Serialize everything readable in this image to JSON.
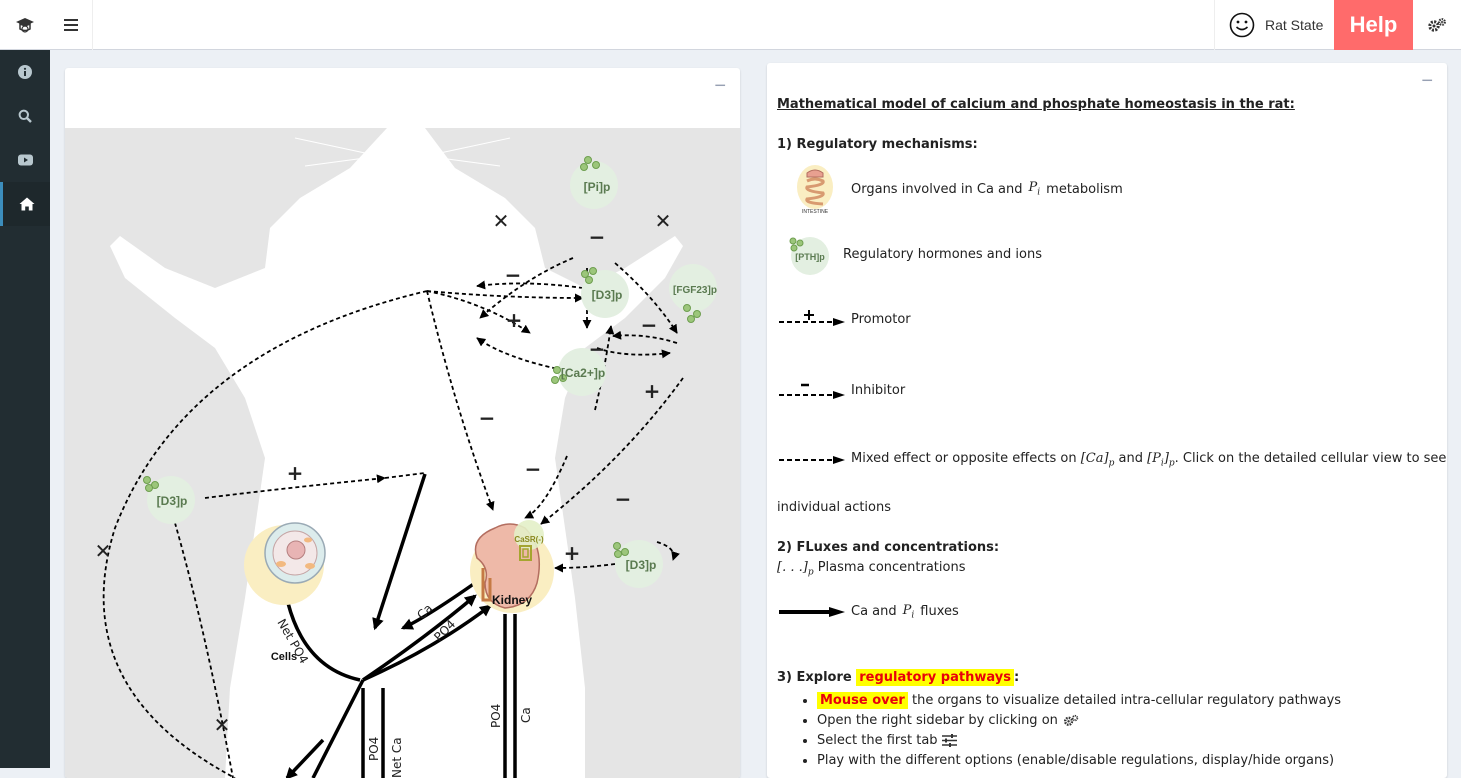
{
  "header": {
    "rat_state_label": "Rat State",
    "help_label": "Help"
  },
  "sidebar": {
    "items": [
      {
        "icon": "info-icon"
      },
      {
        "icon": "search-icon"
      },
      {
        "icon": "video-icon"
      },
      {
        "icon": "home-icon",
        "active": true
      }
    ]
  },
  "left_box": {
    "collapse_label": "−",
    "diagram": {
      "nodes": {
        "pi": "[Pi]p",
        "d3_top": "[D3]p",
        "fgf23": "[FGF23]p",
        "ca2": "[Ca2+]p",
        "d3_left": "[D3]p",
        "d3_right": "[D3]p",
        "casr": "CaSR(-)",
        "cells": "Cells",
        "kidney": "Kidney"
      },
      "signs": {
        "x1": "✕",
        "x2": "✕",
        "x3": "✕",
        "x4": "✕",
        "x5": "✕",
        "minus1": "−",
        "minus2": "−",
        "minus3": "−",
        "minus4": "−",
        "minus5": "−",
        "minus6": "−",
        "minus7": "−",
        "plus1": "+",
        "plus2": "+",
        "plus3": "+",
        "plus4": "+"
      },
      "flux_labels": {
        "ca_kid": "Ca",
        "po4_kid": "PO4",
        "net_po4": "Net PO4",
        "po4_down": "PO4",
        "ca_down": "Ca",
        "po4_vert": "PO4",
        "ca_vert": "Net Ca"
      }
    }
  },
  "right_box": {
    "collapse_label": "−",
    "title": "Mathematical model of calcium and phosphate homeostasis in the rat:",
    "section1": "1) Regulatory mechanisms:",
    "organs_text": "Organs involved in Ca and",
    "organs_math": "P",
    "organs_sub": "i",
    "organs_tail": "metabolism",
    "hormone_icon_label": "[PTH]p",
    "hormones_text": "Regulatory hormones and ions",
    "promotor": "Promotor",
    "inhibitor": "Inhibitor",
    "mixed_text": "Mixed effect or opposite effects on",
    "mixed_ca": "[Ca]",
    "mixed_p": "p",
    "mixed_and": "and",
    "mixed_pi": "[P",
    "mixed_i": "i",
    "mixed_close": "]",
    "mixed_p2": "p",
    "mixed_tail": ". Click on the detailed cellular view to see",
    "mixed_wrap": "individual actions",
    "section2": "2) FLuxes and concentrations:",
    "plasma_bracket": "[. . .]",
    "plasma_sub": "p",
    "plasma_text": "Plasma concentrations",
    "flux_text": "Ca and",
    "flux_math": "P",
    "flux_sub": "i",
    "flux_tail": "fluxes",
    "section3_pre": "3) Explore",
    "section3_hl": "regulatory pathways",
    "section3_post": ":",
    "bullets": {
      "b1_hl": "Mouse over",
      "b1_text": "the organs to visualize detailed intra-cellular regulatory pathways",
      "b2_text": "Open the right sidebar by clicking on",
      "b3_text": "Select the first tab",
      "b4_text": "Play with the different options (enable/disable regulations, display/hide organs)"
    },
    "organ_icon_label": "INTESTINE"
  },
  "colors": {
    "sidebar_bg": "#222d32",
    "help_bg": "#ff6b6b",
    "node_green": "#e3efe1",
    "organ_yellow": "#faeec2",
    "highlight_yellow": "#ffff00",
    "highlight_red": "#e8000b"
  }
}
